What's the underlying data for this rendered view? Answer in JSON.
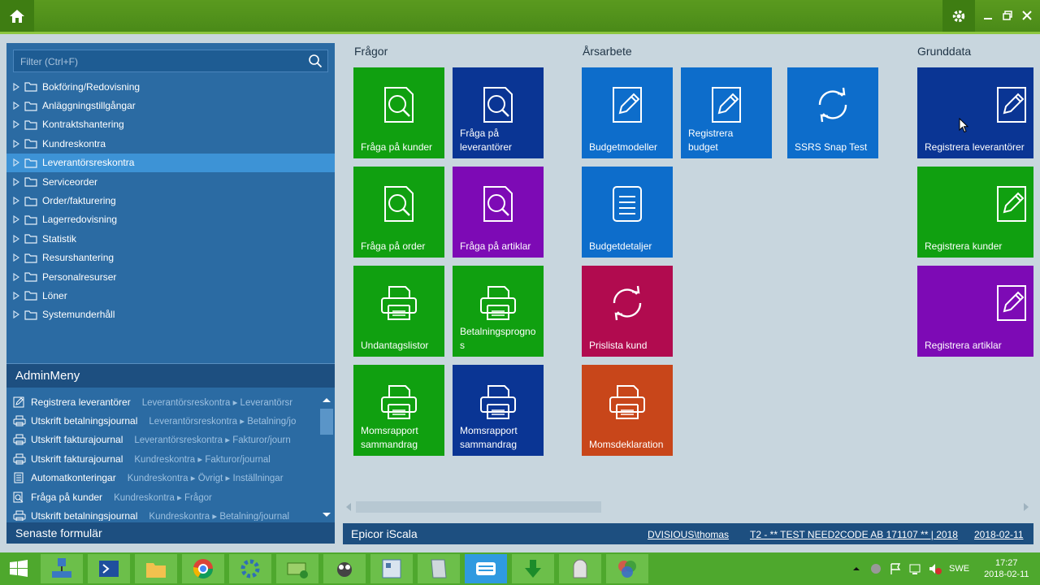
{
  "colors": {
    "accent_green": "#5a9a1f",
    "sidebar_blue": "#2b6ba3",
    "selection": "#3d93d6"
  },
  "sidebar": {
    "filter_placeholder": "Filter (Ctrl+F)",
    "tree": [
      {
        "label": "Bokföring/Redovisning"
      },
      {
        "label": "Anläggningstillgångar"
      },
      {
        "label": "Kontraktshantering"
      },
      {
        "label": "Kundreskontra"
      },
      {
        "label": "Leverantörsreskontra",
        "selected": true
      },
      {
        "label": "Serviceorder"
      },
      {
        "label": "Order/fakturering"
      },
      {
        "label": "Lagerredovisning"
      },
      {
        "label": "Statistik"
      },
      {
        "label": "Resurshantering"
      },
      {
        "label": "Personalresurser"
      },
      {
        "label": "Löner"
      },
      {
        "label": "Systemunderhåll"
      }
    ],
    "admin_title": "AdminMeny",
    "recent": [
      {
        "label": "Registrera leverantörer",
        "path": "Leverantörsreskontra ▸ Leverantörsr",
        "icon": "edit-icon"
      },
      {
        "label": "Utskrift betalningsjournal",
        "path": "Leverantörsreskontra ▸ Betalning/jo",
        "icon": "printer-icon"
      },
      {
        "label": "Utskrift fakturajournal",
        "path": "Leverantörsreskontra ▸ Fakturor/journ",
        "icon": "printer-icon"
      },
      {
        "label": "Utskrift fakturajournal",
        "path": "Kundreskontra ▸ Fakturor/journal",
        "icon": "printer-icon"
      },
      {
        "label": "Automatkonteringar",
        "path": "Kundreskontra ▸ Övrigt ▸ Inställningar",
        "icon": "document-icon"
      },
      {
        "label": "Fråga på kunder",
        "path": "Kundreskontra ▸ Frågor",
        "icon": "search-icon"
      },
      {
        "label": "Utskrift betalningsjournal",
        "path": "Kundreskontra ▸ Betalning/journal",
        "icon": "printer-icon"
      }
    ],
    "recent_title": "Senaste formulär"
  },
  "groups": {
    "fragor": "Frågor",
    "arsarbete": "Årsarbete",
    "grunddata": "Grunddata"
  },
  "tiles": {
    "t1": {
      "label": "Fråga på kunder",
      "icon": "search-icon"
    },
    "t2": {
      "label": "Fråga på leverantörer",
      "icon": "search-icon"
    },
    "t3": {
      "label": "Fråga på order",
      "icon": "search-icon"
    },
    "t4": {
      "label": "Fråga på artiklar",
      "icon": "search-icon"
    },
    "t5": {
      "label": "Undantagslistor",
      "icon": "printer-icon"
    },
    "t6": {
      "label": "Betalningsprognos",
      "icon": "printer-icon"
    },
    "t7": {
      "label": "Momsrapport sammandrag",
      "icon": "printer-icon"
    },
    "t8": {
      "label": "Momsrapport sammandrag",
      "icon": "printer-icon"
    },
    "t9": {
      "label": "Budgetmodeller",
      "icon": "edit-icon"
    },
    "t10": {
      "label": "Registrera budget",
      "icon": "edit-icon"
    },
    "t11": {
      "label": "SSRS Snap Test",
      "icon": "refresh-icon"
    },
    "t12": {
      "label": "Budgetdetaljer",
      "icon": "document-icon"
    },
    "t13": {
      "label": "Prislista kund",
      "icon": "refresh-icon"
    },
    "t14": {
      "label": "Momsdeklaration",
      "icon": "printer-icon"
    },
    "t15": {
      "label": "Registrera leverantörer",
      "icon": "edit-icon"
    },
    "t16": {
      "label": "Registrera kunder",
      "icon": "edit-icon"
    },
    "t17": {
      "label": "Registrera artiklar",
      "icon": "edit-icon"
    }
  },
  "status": {
    "brand": "Epicor iScala",
    "user": "DVISIOUS\\thomas",
    "company": "T2 - ** TEST NEED2CODE AB 171107 ** | 2018",
    "date": "2018-02-11"
  },
  "taskbar": {
    "lang": "SWE",
    "time": "17:27",
    "date": "2018-02-11"
  }
}
